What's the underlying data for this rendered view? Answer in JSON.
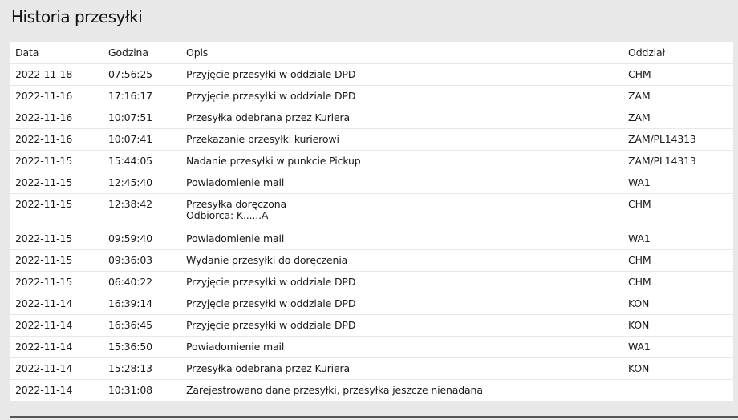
{
  "title": "Historia przesyłki",
  "headers": {
    "date": "Data",
    "time": "Godzina",
    "desc": "Opis",
    "branch": "Oddział"
  },
  "rows": [
    {
      "date": "2022-11-18",
      "time": "07:56:25",
      "desc": "Przyjęcie przesyłki w oddziale DPD",
      "desc2": "",
      "branch": "CHM"
    },
    {
      "date": "2022-11-16",
      "time": "17:16:17",
      "desc": "Przyjęcie przesyłki w oddziale DPD",
      "desc2": "",
      "branch": "ZAM"
    },
    {
      "date": "2022-11-16",
      "time": "10:07:51",
      "desc": "Przesyłka odebrana przez Kuriera",
      "desc2": "",
      "branch": "ZAM"
    },
    {
      "date": "2022-11-16",
      "time": "10:07:41",
      "desc": "Przekazanie przesyłki kurierowi",
      "desc2": "",
      "branch": "ZAM/PL14313"
    },
    {
      "date": "2022-11-15",
      "time": "15:44:05",
      "desc": "Nadanie przesyłki w punkcie Pickup",
      "desc2": "",
      "branch": "ZAM/PL14313"
    },
    {
      "date": "2022-11-15",
      "time": "12:45:40",
      "desc": "Powiadomienie mail",
      "desc2": "",
      "branch": "WA1"
    },
    {
      "date": "2022-11-15",
      "time": "12:38:42",
      "desc": "Przesyłka doręczona",
      "desc2": "Odbiorca: K......A",
      "branch": "CHM"
    },
    {
      "date": "2022-11-15",
      "time": "09:59:40",
      "desc": "Powiadomienie mail",
      "desc2": "",
      "branch": "WA1"
    },
    {
      "date": "2022-11-15",
      "time": "09:36:03",
      "desc": "Wydanie przesyłki do doręczenia",
      "desc2": "",
      "branch": "CHM"
    },
    {
      "date": "2022-11-15",
      "time": "06:40:22",
      "desc": "Przyjęcie przesyłki w oddziale DPD",
      "desc2": "",
      "branch": "CHM"
    },
    {
      "date": "2022-11-14",
      "time": "16:39:14",
      "desc": "Przyjęcie przesyłki w oddziale DPD",
      "desc2": "",
      "branch": "KON"
    },
    {
      "date": "2022-11-14",
      "time": "16:36:45",
      "desc": "Przyjęcie przesyłki w oddziale DPD",
      "desc2": "",
      "branch": "KON"
    },
    {
      "date": "2022-11-14",
      "time": "15:36:50",
      "desc": "Powiadomienie mail",
      "desc2": "",
      "branch": "WA1"
    },
    {
      "date": "2022-11-14",
      "time": "15:28:13",
      "desc": "Przesyłka odebrana przez Kuriera",
      "desc2": "",
      "branch": "KON"
    },
    {
      "date": "2022-11-14",
      "time": "10:31:08",
      "desc": "Zarejestrowano dane przesyłki, przesyłka jeszcze nienadana",
      "desc2": "",
      "branch": ""
    }
  ]
}
